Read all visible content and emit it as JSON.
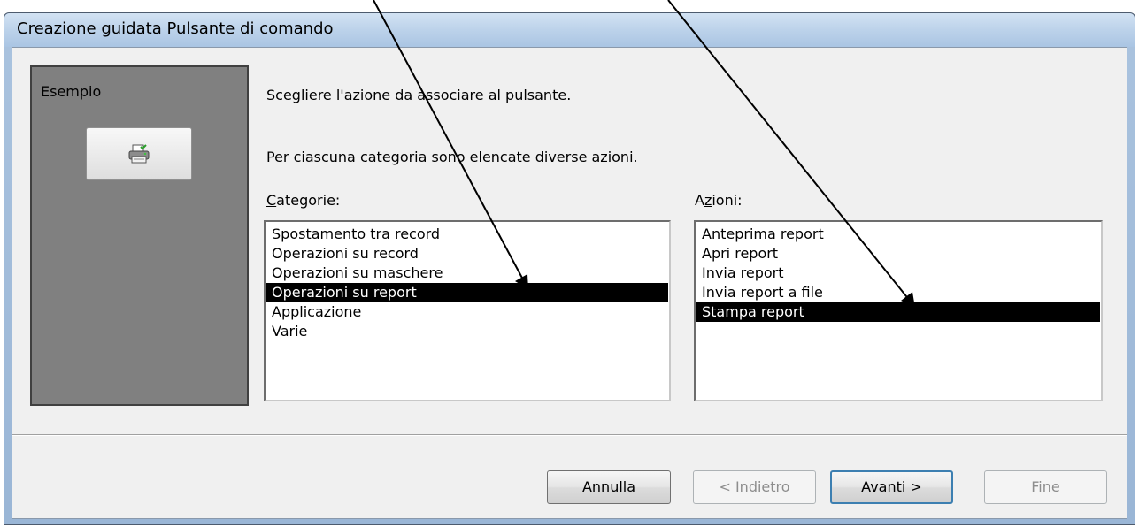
{
  "window": {
    "title": "Creazione guidata Pulsante di comando"
  },
  "preview": {
    "label": "Esempio",
    "icon": "printer-icon"
  },
  "instructions": {
    "line1": "Scegliere l'azione da associare al pulsante.",
    "line2": "Per ciascuna categoria sono elencate diverse azioni."
  },
  "categories": {
    "label_first": "C",
    "label_rest": "ategorie:",
    "items": [
      "Spostamento tra record",
      "Operazioni su record",
      "Operazioni su maschere",
      "Operazioni su report",
      "Applicazione",
      "Varie"
    ],
    "selected": "Operazioni su report"
  },
  "actions": {
    "label_first": "A",
    "label_u": "z",
    "label_rest": "ioni:",
    "items": [
      "Anteprima report",
      "Apri report",
      "Invia report",
      "Invia report a file",
      "Stampa report"
    ],
    "selected": "Stampa report"
  },
  "buttons": {
    "cancel": "Annulla",
    "back_prefix": "< ",
    "back_u": "I",
    "back_rest": "ndietro",
    "next_u": "A",
    "next_rest": "vanti >",
    "finish_u": "F",
    "finish_rest": "ine"
  },
  "colors": {
    "selection": "#000000",
    "preview_panel": "#808080",
    "default_button_border": "#3c7fb1"
  }
}
